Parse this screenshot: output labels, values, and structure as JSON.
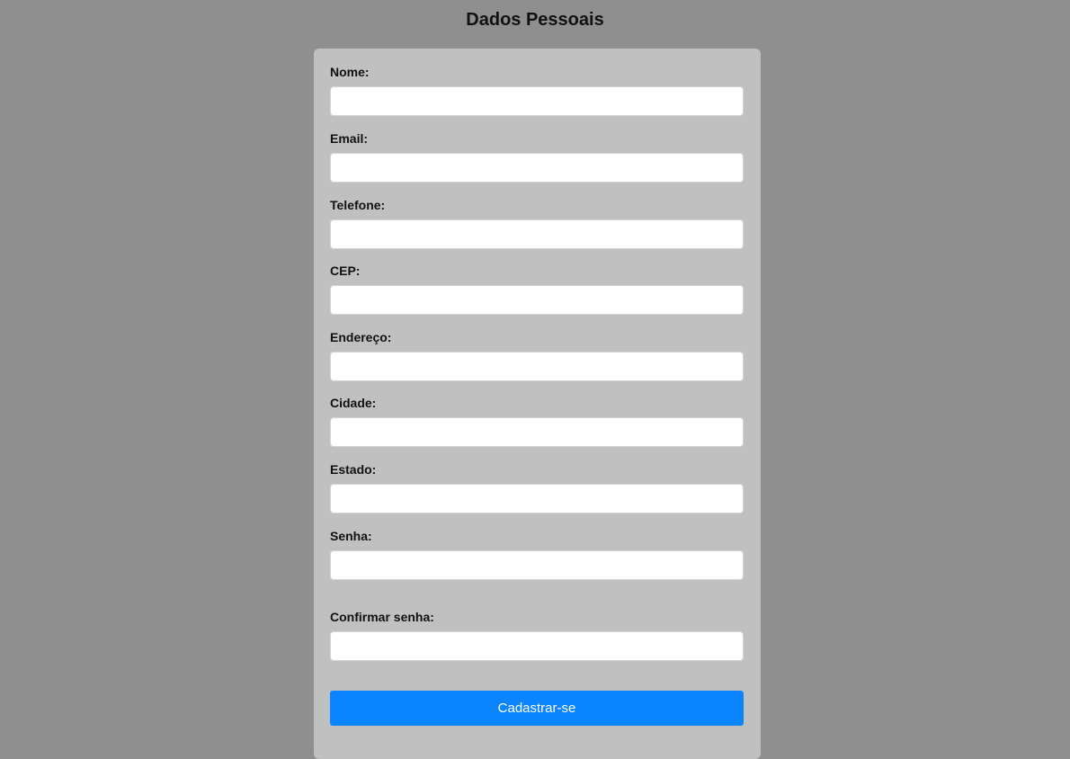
{
  "page": {
    "title": "Dados Pessoais"
  },
  "form": {
    "fields": [
      {
        "label": "Nome:",
        "value": "",
        "placeholder": ""
      },
      {
        "label": "Email:",
        "value": "",
        "placeholder": ""
      },
      {
        "label": "Telefone:",
        "value": "",
        "placeholder": ""
      },
      {
        "label": "CEP:",
        "value": "",
        "placeholder": ""
      },
      {
        "label": "Endereço:",
        "value": "",
        "placeholder": ""
      },
      {
        "label": "Cidade:",
        "value": "",
        "placeholder": ""
      },
      {
        "label": "Estado:",
        "value": "",
        "placeholder": ""
      },
      {
        "label": "Senha:",
        "value": "",
        "placeholder": ""
      },
      {
        "label": "Confirmar senha:",
        "value": "",
        "placeholder": ""
      }
    ],
    "submit_label": "Cadastrar-se"
  },
  "colors": {
    "background": "#8f8f8f",
    "card": "#c0c0c0",
    "button": "#0a84ff",
    "button_text": "#ffffff"
  }
}
